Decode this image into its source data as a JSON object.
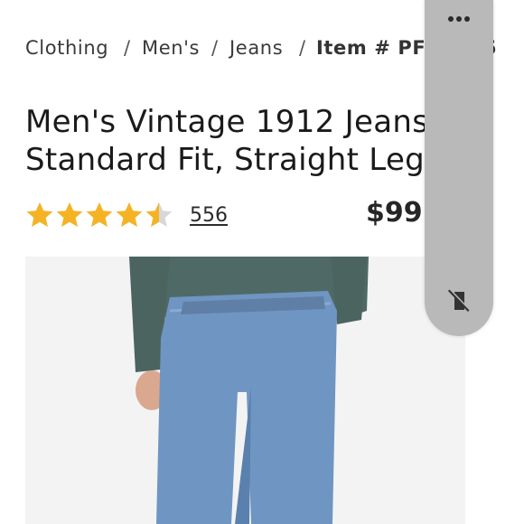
{
  "breadcrumb": {
    "items": [
      "Clothing",
      "Men's",
      "Jeans"
    ],
    "separator": "/",
    "item_number": "Item # PF5",
    "item_number_tail": "5"
  },
  "product": {
    "title_line1": "Men's Vintage 1912 Jeans",
    "title_line2": "Standard Fit, Straight Leg",
    "rating": 4.5,
    "rating_max": 5,
    "review_count": "556",
    "price": "$99."
  },
  "image": {
    "description_icon": "product-photo"
  },
  "overlay": {
    "icons": [
      "more-icon",
      "mute-icon"
    ]
  },
  "colors": {
    "star": "#f5b324",
    "star_empty": "#d8d8d8",
    "overlay": "#b9b9b9"
  }
}
